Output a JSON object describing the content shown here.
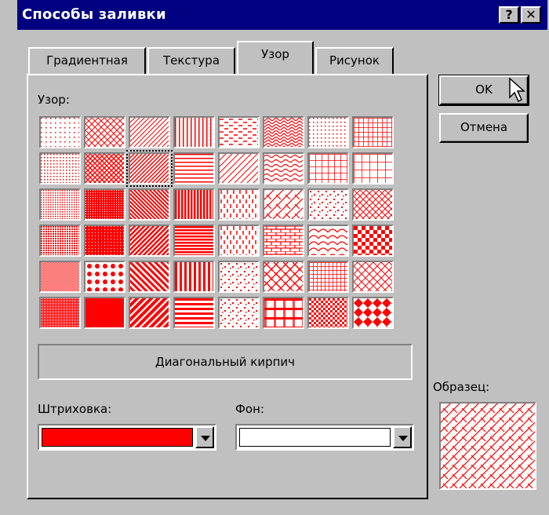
{
  "window": {
    "title": "Способы заливки",
    "help_label": "?",
    "close_label": "✕"
  },
  "tabs": [
    {
      "label": "Градиентная"
    },
    {
      "label": "Текстура"
    },
    {
      "label": "Узор"
    },
    {
      "label": "Рисунок"
    }
  ],
  "pattern_section": {
    "label": "Узор:"
  },
  "pattern_name": "Диагональный кирпич",
  "selected_pattern_index": 13,
  "foreground": {
    "label": "Штриховка:",
    "color": "#ff0000"
  },
  "background": {
    "label": "Фон:",
    "color": "#ffffff"
  },
  "sample": {
    "label": "Образец:"
  },
  "buttons": {
    "ok": "OK",
    "cancel": "Отмена"
  },
  "colors": {
    "titlebar": "#000080",
    "pattern": "#ff0000",
    "face": "#c0c0c0"
  }
}
